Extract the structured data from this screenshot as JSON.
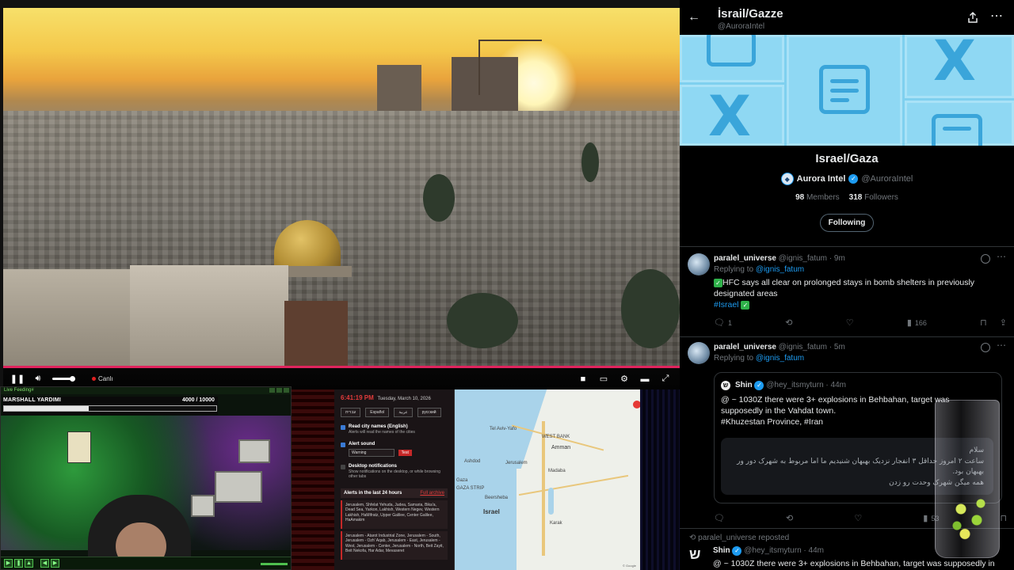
{
  "video": {
    "live_label": "Canlı",
    "progress_fraction": 1.0,
    "icons": [
      "pause-icon",
      "volume-icon",
      "stop-icon",
      "pip-icon",
      "settings-icon",
      "theater-icon",
      "fullscreen-icon"
    ]
  },
  "cam": {
    "window_title": "Live Feeding#",
    "hp_label": "MARSHALL YARDIMI",
    "hp_value": "4000  / 10000",
    "hp_fraction": 0.4,
    "sign_text": "DİKKAT"
  },
  "alerts_app": {
    "time": "6:41:19 PM",
    "date": "Tuesday, March 10, 2026",
    "languages": [
      "עברית",
      "Español",
      "عربية",
      "русский"
    ],
    "option_city_title": "Read city names (English)",
    "option_city_sub": "Alerts will read the names of the cities",
    "option_sound_title": "Alert sound",
    "sound_value": "Warning",
    "test_label": "Test",
    "option_desktop_title": "Desktop notifications",
    "option_desktop_sub": "Show notifications on the desktop, or while browsing other tabs",
    "list_title": "Alerts in the last 24 hours",
    "archive_link": "Full archive",
    "entries": [
      "Jerusalem, Shfelat Yehuda, Judea, Samaria, Bika'a, Dead Sea, Yarkon, Lakhish, Western Negev, Western Lakhish, HaMifratz, Upper Galilee, Center Galilee, HaAmakim",
      "Jerusalem - Atarot Industrial Zone, Jerusalem - South, Jerusalem - Ozh' Aqab, Jerusalem - East, Jerusalem - West, Jerusalem - Center, Jerusalem - North, Beit Zayit, Beit Nekofa, Har Adar, Mevaseret"
    ]
  },
  "map": {
    "labels": [
      "Tel Aviv-Yafo",
      "WEST BANK",
      "Ashdod",
      "Jerusalem",
      "Amman",
      "Madaba",
      "Gaza",
      "GAZA STRIP",
      "Israel",
      "Beersheba",
      "Karak"
    ],
    "attribution": "© Google"
  },
  "x": {
    "list_title": "İsrail/Gazze",
    "list_handle": "@AuroraIntel",
    "list_name": "Israel/Gaza",
    "owner_name": "Aurora Intel",
    "owner_handle": "@AuroraIntel",
    "members_count": "98",
    "members_label": "Members",
    "followers_count": "318",
    "followers_label": "Followers",
    "follow_button": "Following",
    "tweets": [
      {
        "name": "paralel_universe",
        "handle": "@ignis_fatum",
        "time": "9m",
        "replying_prefix": "Replying to",
        "replying_to": "@ignis_fatum",
        "text": "HFC says all clear on prolonged stays in bomb shelters in previously designated areas",
        "hashtag": "#Israel",
        "replies": "1",
        "views": "166"
      },
      {
        "name": "paralel_universe",
        "handle": "@ignis_fatum",
        "time": "5m",
        "replying_prefix": "Replying to",
        "replying_to": "@ignis_fatum",
        "quote_name": "Shin",
        "quote_handle": "@hey_itsmyturn",
        "quote_time": "44m",
        "quote_text": "@ ~ 1030Z there were 3+ explosions in Behbahan, target was supposedly in the Vahdat town.",
        "quote_tags": "#Khuzestan Province, #Iran",
        "quote_persian_1": "سلام",
        "quote_persian_2": "ساعت ۲ امروز حداقل ۳ انفجار نزدیک بهبهان شنیدیم ما اما مربوط به شهرک دور ور بهبهان بود.",
        "quote_persian_3": "همه میگن شهرک وحدت رو زدن",
        "views": "53"
      }
    ],
    "repost_label": "paralel_universe reposted",
    "third": {
      "name": "Shin",
      "handle": "@hey_itsmyturn",
      "time": "44m",
      "text": "@ ~ 1030Z there were 3+ explosions in Behbahan, target was supposedly in"
    }
  }
}
